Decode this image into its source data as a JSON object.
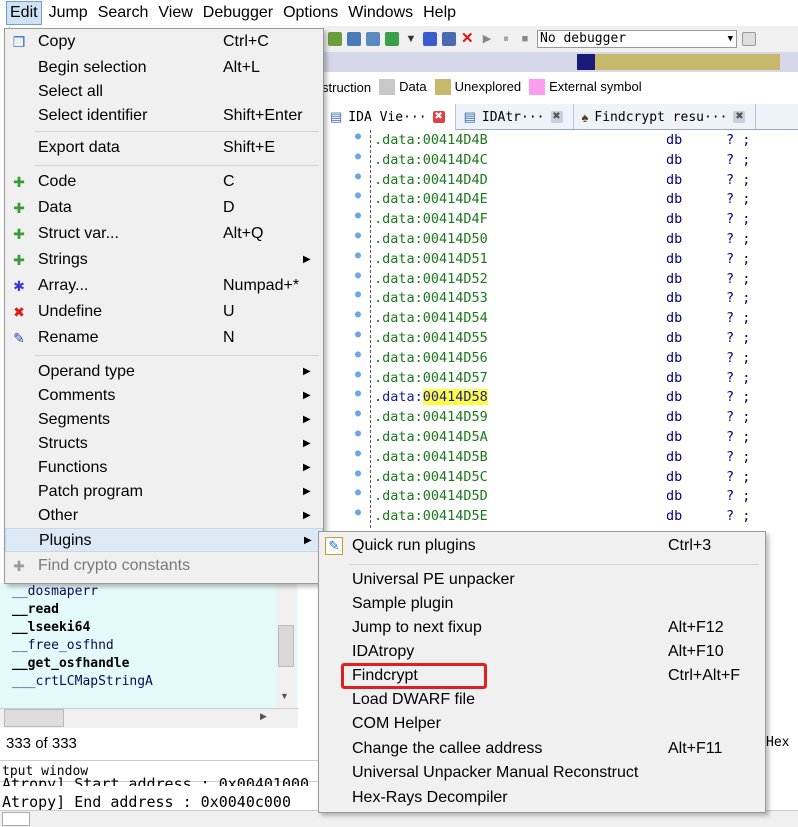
{
  "menubar": [
    "Edit",
    "Jump",
    "Search",
    "View",
    "Debugger",
    "Options",
    "Windows",
    "Help"
  ],
  "toolbar": {
    "debugger_label": "No debugger"
  },
  "legend": [
    {
      "label": "struction",
      "color": "#d0d0d0"
    },
    {
      "label": "Data",
      "color": "#c8c8c8"
    },
    {
      "label": "Unexplored",
      "color": "#c8b86c"
    },
    {
      "label": "External symbol",
      "color": "#ff9cf0"
    }
  ],
  "tabs": [
    {
      "label": "IDA Vie···",
      "close": "✖"
    },
    {
      "label": "IDAtr···",
      "close": "✖"
    },
    {
      "label": "Findcrypt resu···",
      "close": "✖"
    }
  ],
  "disasm": [
    {
      "addr": ".data:00414D4B",
      "op": "db",
      "arg": "? ;"
    },
    {
      "addr": ".data:00414D4C",
      "op": "db",
      "arg": "? ;"
    },
    {
      "addr": ".data:00414D4D",
      "op": "db",
      "arg": "? ;"
    },
    {
      "addr": ".data:00414D4E",
      "op": "db",
      "arg": "? ;"
    },
    {
      "addr": ".data:00414D4F",
      "op": "db",
      "arg": "? ;"
    },
    {
      "addr": ".data:00414D50",
      "op": "db",
      "arg": "? ;"
    },
    {
      "addr": ".data:00414D51",
      "op": "db",
      "arg": "? ;"
    },
    {
      "addr": ".data:00414D52",
      "op": "db",
      "arg": "? ;"
    },
    {
      "addr": ".data:00414D53",
      "op": "db",
      "arg": "? ;"
    },
    {
      "addr": ".data:00414D54",
      "op": "db",
      "arg": "? ;"
    },
    {
      "addr": ".data:00414D55",
      "op": "db",
      "arg": "? ;"
    },
    {
      "addr": ".data:00414D56",
      "op": "db",
      "arg": "? ;"
    },
    {
      "addr": ".data:00414D57",
      "op": "db",
      "arg": "? ;"
    },
    {
      "addr": ".data:00414D58",
      "op": "db",
      "arg": "? ;",
      "selected": true
    },
    {
      "addr": ".data:00414D59",
      "op": "db",
      "arg": "? ;"
    },
    {
      "addr": ".data:00414D5A",
      "op": "db",
      "arg": "? ;"
    },
    {
      "addr": ".data:00414D5B",
      "op": "db",
      "arg": "? ;"
    },
    {
      "addr": ".data:00414D5C",
      "op": "db",
      "arg": "? ;"
    },
    {
      "addr": ".data:00414D5D",
      "op": "db",
      "arg": "? ;"
    },
    {
      "addr": ".data:00414D5E",
      "op": "db",
      "arg": "? ;"
    }
  ],
  "functions": [
    {
      "name": "__dosmaperr",
      "bold": false
    },
    {
      "name": "__read",
      "bold": true
    },
    {
      "name": "__lseeki64",
      "bold": true
    },
    {
      "name": "__free_osfhnd",
      "bold": false
    },
    {
      "name": "__get_osfhandle",
      "bold": true
    },
    {
      "name": "___crtLCMapStringA",
      "bold": false
    }
  ],
  "status": {
    "count": "333 of 333",
    "hex_label": "Hex"
  },
  "output": {
    "title": "tput window",
    "lines": [
      "Atropy] Start address : 0x00401000",
      "Atropy] End address : 0x0040c000"
    ]
  },
  "edit_menu": [
    {
      "label": "Copy",
      "shortcut": "Ctrl+C",
      "icon": "copy-icon"
    },
    {
      "label": "Begin selection",
      "shortcut": "Alt+L"
    },
    {
      "label": "Select all",
      "shortcut": ""
    },
    {
      "label": "Select identifier",
      "shortcut": "Shift+Enter"
    },
    {
      "label": "Export data",
      "shortcut": "Shift+E"
    },
    {
      "label": "Code",
      "shortcut": "C",
      "icon": "code-icon"
    },
    {
      "label": "Data",
      "shortcut": "D",
      "icon": "data-icon"
    },
    {
      "label": "Struct var...",
      "shortcut": "Alt+Q",
      "icon": "struct-icon"
    },
    {
      "label": "Strings",
      "shortcut": "",
      "icon": "strings-icon",
      "submenu": true
    },
    {
      "label": "Array...",
      "shortcut": "Numpad+*",
      "icon": "array-icon"
    },
    {
      "label": "Undefine",
      "shortcut": "U",
      "icon": "undefine-icon"
    },
    {
      "label": "Rename",
      "shortcut": "N",
      "icon": "rename-icon"
    },
    {
      "label": "Operand type",
      "submenu": true
    },
    {
      "label": "Comments",
      "submenu": true
    },
    {
      "label": "Segments",
      "submenu": true
    },
    {
      "label": "Structs",
      "submenu": true
    },
    {
      "label": "Functions",
      "submenu": true
    },
    {
      "label": "Patch program",
      "submenu": true
    },
    {
      "label": "Other",
      "submenu": true
    },
    {
      "label": "Plugins",
      "submenu": true,
      "highlight": true
    },
    {
      "label": "Find crypto constants",
      "disabled": true,
      "icon": "crypto-icon"
    }
  ],
  "plugins_menu": [
    {
      "label": "Quick run plugins",
      "shortcut": "Ctrl+3",
      "icon": "quick-run-icon"
    },
    {
      "label": "Universal PE unpacker",
      "shortcut": ""
    },
    {
      "label": "Sample plugin",
      "shortcut": ""
    },
    {
      "label": "Jump to next fixup",
      "shortcut": "Alt+F12"
    },
    {
      "label": "IDAtropy",
      "shortcut": "Alt+F10"
    },
    {
      "label": "Findcrypt",
      "shortcut": "Ctrl+Alt+F",
      "outlined": true
    },
    {
      "label": "Load DWARF file",
      "shortcut": ""
    },
    {
      "label": "COM Helper",
      "shortcut": ""
    },
    {
      "label": "Change the callee address",
      "shortcut": "Alt+F11"
    },
    {
      "label": "Universal Unpacker Manual Reconstruct",
      "shortcut": ""
    },
    {
      "label": "Hex-Rays Decompiler",
      "shortcut": ""
    }
  ]
}
